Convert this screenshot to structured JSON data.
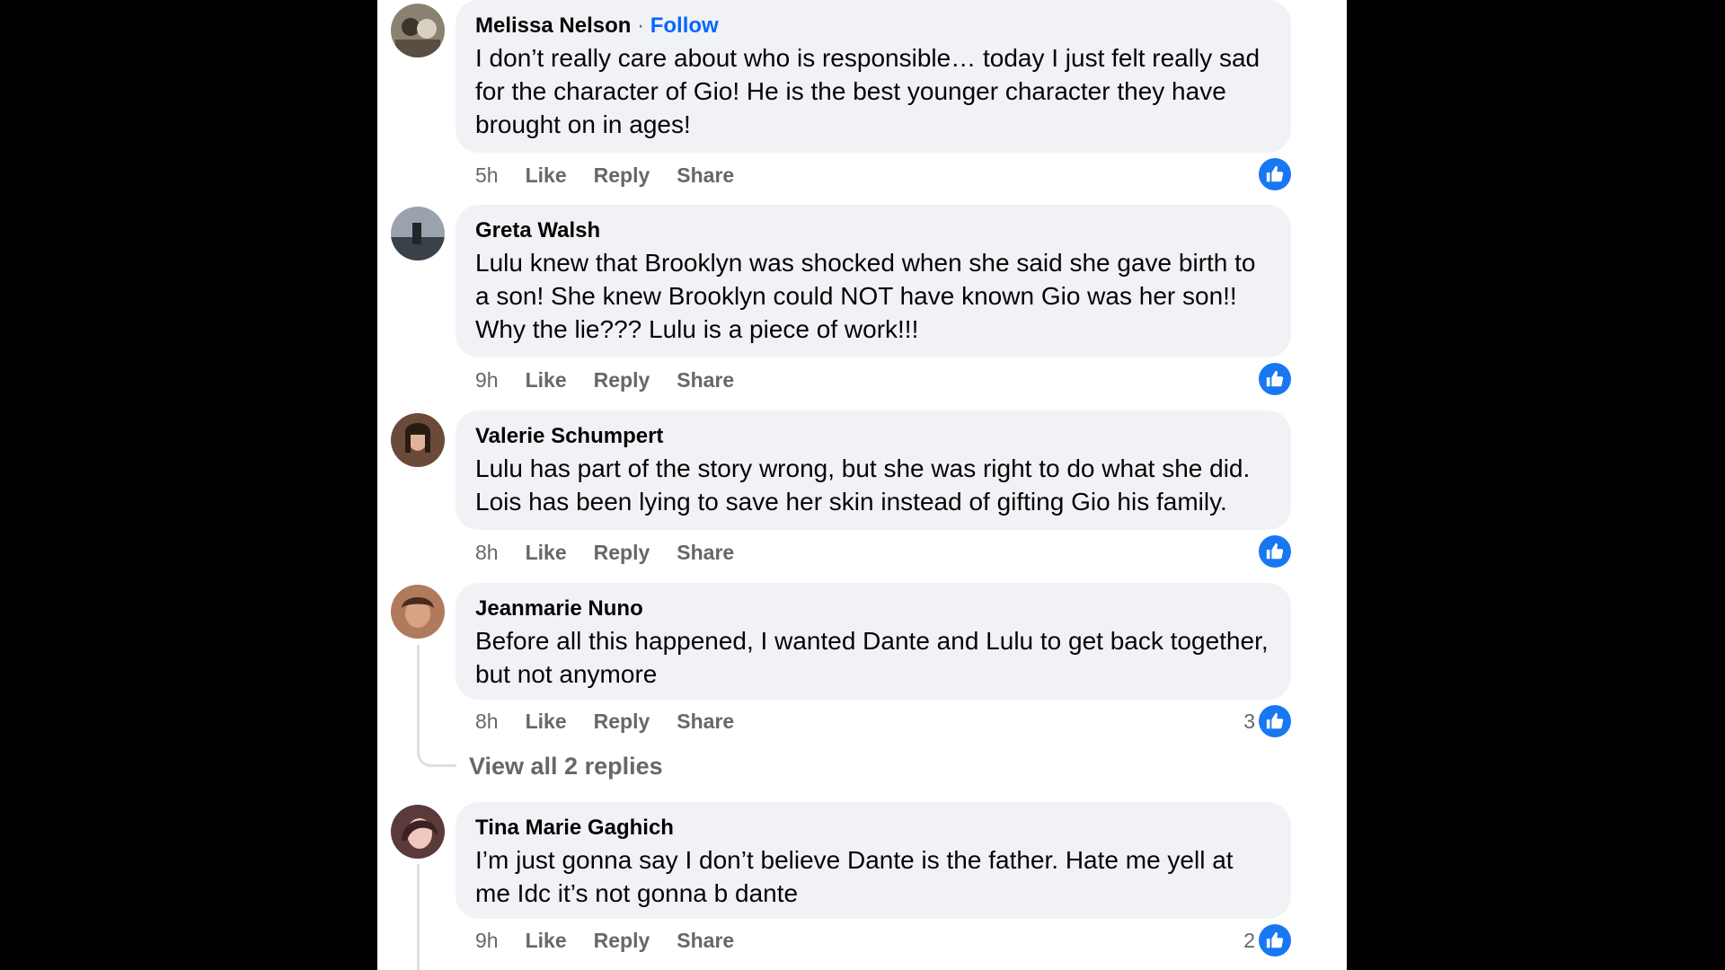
{
  "follow_label": "Follow",
  "like_color": "#1877f2",
  "comments": [
    {
      "author": "Melissa Nelson",
      "text": "I don’t really care about who is responsible… today I just felt really sad for the character of Gio! He is the best younger character they have brought on in ages!",
      "time": "5h",
      "like": "Like",
      "reply": "Reply",
      "share": "Share",
      "reaction_count": ""
    },
    {
      "author": "Greta Walsh",
      "text": "Lulu knew that Brooklyn was shocked when she said she gave birth to a son! She knew Brooklyn could NOT have known Gio was her son!! Why the lie??? Lulu is a piece of work!!!",
      "time": "9h",
      "like": "Like",
      "reply": "Reply",
      "share": "Share",
      "reaction_count": ""
    },
    {
      "author": "Valerie Schumpert",
      "text": "Lulu has part of the story wrong, but she was right to do what she did. Lois has been lying to save her skin instead of gifting Gio his family.",
      "time": "8h",
      "like": "Like",
      "reply": "Reply",
      "share": "Share",
      "reaction_count": ""
    },
    {
      "author": "Jeanmarie Nuno",
      "text": "Before all this happened, I wanted Dante and Lulu to get back together, but not anymore",
      "time": "8h",
      "like": "Like",
      "reply": "Reply",
      "share": "Share",
      "reaction_count": "3",
      "view_replies": "View all 2 replies"
    },
    {
      "author": "Tina Marie Gaghich",
      "text": "I’m just gonna say I don’t believe Dante is the father. Hate me yell at me Idc it’s not gonna b dante",
      "time": "9h",
      "like": "Like",
      "reply": "Reply",
      "share": "Share",
      "reaction_count": "2"
    }
  ]
}
